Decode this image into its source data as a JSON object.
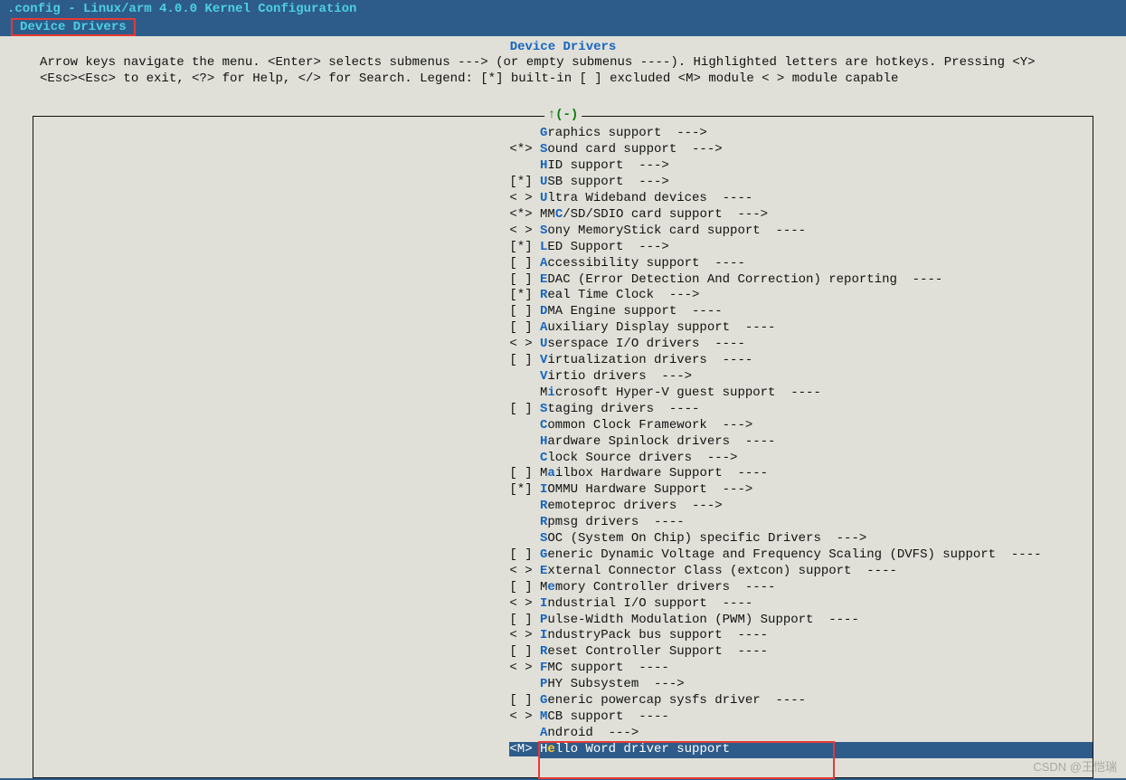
{
  "title": ".config - Linux/arm 4.0.0 Kernel Configuration",
  "breadcrumb": "Device Drivers",
  "screen_title": "Device Drivers",
  "help_line1": "Arrow keys navigate the menu.  <Enter> selects submenus ---> (or empty submenus ----).  Highlighted letters are hotkeys.  Pressing <Y>",
  "help_line2": "<Esc><Esc> to exit, <?> for Help, </> for Search.  Legend: [*] built-in  [ ] excluded  <M> module  < > module capable",
  "scroll_indicator": "↑(-)",
  "watermark": "CSDN @王恺瑞",
  "items": [
    {
      "prefix": "    ",
      "hot": "G",
      "rest": "raphics support  --->"
    },
    {
      "prefix": "<*> ",
      "hot": "S",
      "rest": "ound card support  --->"
    },
    {
      "prefix": "    ",
      "hot": "H",
      "rest": "ID support  --->"
    },
    {
      "prefix": "[*] ",
      "hot": "U",
      "rest": "SB support  --->"
    },
    {
      "prefix": "< > ",
      "hot": "U",
      "rest": "ltra Wideband devices  ----"
    },
    {
      "prefix": "<*> ",
      "pre": "MM",
      "hot": "C",
      "rest": "/SD/SDIO card support  --->"
    },
    {
      "prefix": "< > ",
      "hot": "S",
      "rest": "ony MemoryStick card support  ----"
    },
    {
      "prefix": "[*] ",
      "hot": "L",
      "rest": "ED Support  --->"
    },
    {
      "prefix": "[ ] ",
      "hot": "A",
      "rest": "ccessibility support  ----"
    },
    {
      "prefix": "[ ] ",
      "hot": "E",
      "rest": "DAC (Error Detection And Correction) reporting  ----"
    },
    {
      "prefix": "[*] ",
      "hot": "R",
      "rest": "eal Time Clock  --->"
    },
    {
      "prefix": "[ ] ",
      "hot": "D",
      "rest": "MA Engine support  ----"
    },
    {
      "prefix": "[ ] ",
      "hot": "A",
      "rest": "uxiliary Display support  ----"
    },
    {
      "prefix": "< > ",
      "hot": "U",
      "rest": "serspace I/O drivers  ----"
    },
    {
      "prefix": "[ ] ",
      "hot": "V",
      "rest": "irtualization drivers  ----"
    },
    {
      "prefix": "    ",
      "hot": "V",
      "rest": "irtio drivers  --->"
    },
    {
      "prefix": "    ",
      "pre": "M",
      "hot": "i",
      "rest": "crosoft Hyper-V guest support  ----"
    },
    {
      "prefix": "[ ] ",
      "hot": "S",
      "rest": "taging drivers  ----"
    },
    {
      "prefix": "    ",
      "hot": "C",
      "rest": "ommon Clock Framework  --->"
    },
    {
      "prefix": "    ",
      "hot": "H",
      "rest": "ardware Spinlock drivers  ----"
    },
    {
      "prefix": "    ",
      "hot": "C",
      "rest": "lock Source drivers  --->"
    },
    {
      "prefix": "[ ] ",
      "pre": "M",
      "hot": "a",
      "rest": "ilbox Hardware Support  ----"
    },
    {
      "prefix": "[*] ",
      "hot": "I",
      "rest": "OMMU Hardware Support  --->"
    },
    {
      "prefix": "    ",
      "hot": "R",
      "rest": "emoteproc drivers  --->"
    },
    {
      "prefix": "    ",
      "hot": "R",
      "rest": "pmsg drivers  ----"
    },
    {
      "prefix": "    ",
      "hot": "S",
      "rest": "OC (System On Chip) specific Drivers  --->"
    },
    {
      "prefix": "[ ] ",
      "hot": "G",
      "rest": "eneric Dynamic Voltage and Frequency Scaling (DVFS) support  ----"
    },
    {
      "prefix": "< > ",
      "hot": "E",
      "rest": "xternal Connector Class (extcon) support  ----"
    },
    {
      "prefix": "[ ] ",
      "pre": "M",
      "hot": "e",
      "rest": "mory Controller drivers  ----"
    },
    {
      "prefix": "< > ",
      "hot": "I",
      "rest": "ndustrial I/O support  ----"
    },
    {
      "prefix": "[ ] ",
      "hot": "P",
      "rest": "ulse-Width Modulation (PWM) Support  ----"
    },
    {
      "prefix": "< > ",
      "hot": "I",
      "rest": "ndustryPack bus support  ----"
    },
    {
      "prefix": "[ ] ",
      "hot": "R",
      "rest": "eset Controller Support  ----"
    },
    {
      "prefix": "< > ",
      "hot": "F",
      "rest": "MC support  ----"
    },
    {
      "prefix": "    ",
      "hot": "P",
      "rest": "HY Subsystem  --->"
    },
    {
      "prefix": "[ ] ",
      "hot": "G",
      "rest": "eneric powercap sysfs driver  ----"
    },
    {
      "prefix": "< > ",
      "hot": "M",
      "rest": "CB support  ----"
    },
    {
      "prefix": "    ",
      "hot": "A",
      "rest": "ndroid  --->"
    },
    {
      "prefix": "<M> ",
      "pre": "H",
      "hot": "e",
      "rest": "llo Word driver support",
      "selected": true
    }
  ]
}
